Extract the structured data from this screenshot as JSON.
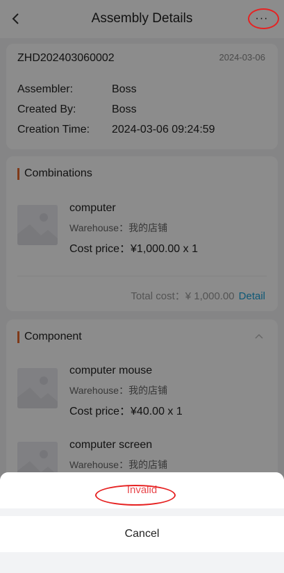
{
  "header": {
    "title": "Assembly Details",
    "more_label": "···"
  },
  "summary": {
    "doc_no": "ZHD202403060002",
    "date": "2024-03-06",
    "rows": [
      {
        "label": "Assembler:",
        "value": "Boss"
      },
      {
        "label": "Created By:",
        "value": "Boss"
      },
      {
        "label": "Creation Time:",
        "value": "2024-03-06 09:24:59"
      }
    ]
  },
  "combinations": {
    "title": "Combinations",
    "items": [
      {
        "name": "computer",
        "warehouse": "Warehouse：我的店铺",
        "cost": "Cost price：¥1,000.00 x 1"
      }
    ],
    "total_label": "Total cost：¥ 1,000.00",
    "detail_label": "Detail"
  },
  "components": {
    "title": "Component",
    "items": [
      {
        "name": "computer mouse",
        "warehouse": "Warehouse：我的店铺",
        "cost": "Cost price：¥40.00 x 1"
      },
      {
        "name": "computer screen",
        "warehouse": "Warehouse：我的店铺",
        "cost": ""
      }
    ]
  },
  "action_sheet": {
    "option_label": "Invalid",
    "cancel_label": "Cancel"
  },
  "colors": {
    "accent": "#e8692c",
    "link": "#1aa0d8",
    "danger": "#e8484d",
    "annotation": "#e62222"
  }
}
